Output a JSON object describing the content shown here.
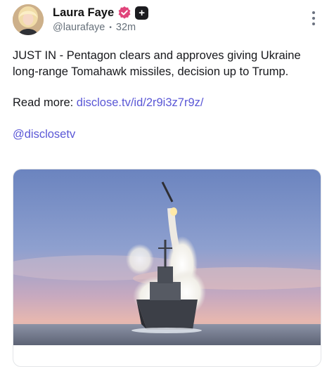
{
  "post": {
    "author": {
      "display_name": "Laura Faye",
      "handle": "@laurafaye",
      "separator": "•",
      "time_ago": "32m"
    },
    "badges": {
      "verified_icon": "verified-badge-icon",
      "plus_icon": "plus-badge-icon",
      "plus_label": "+"
    },
    "menu_icon": "more-vertical-icon",
    "text": {
      "headline": "JUST IN - Pentagon clears and approves giving Ukraine long-range Tomahawk missiles, decision up to Trump.",
      "read_more_label": "Read more: ",
      "read_more_link": "disclose.tv/id/2r9i3z7r9z/",
      "mention": "@disclosetv"
    },
    "colors": {
      "link": "#5a57d6",
      "verified": "#e0457b"
    }
  }
}
